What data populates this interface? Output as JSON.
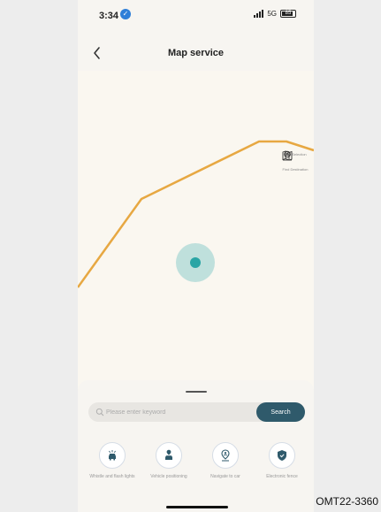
{
  "status_bar": {
    "time": "3:34",
    "time_badge": "✓",
    "network": "5G",
    "battery": "85"
  },
  "header": {
    "title": "Map service",
    "back_icon": "chevron-left-icon"
  },
  "map": {
    "route_color": "#e7a842",
    "location_color": "#2aa5a5",
    "tools": [
      {
        "icon": "map-icon",
        "label": "Map Selection"
      },
      {
        "icon": "location-person-icon",
        "label": "Find Destination"
      },
      {
        "icon": "compass-icon",
        "label": ""
      }
    ]
  },
  "search": {
    "placeholder": "Please enter keyword",
    "button_label": "Search"
  },
  "actions": [
    {
      "icon": "car-lights-icon",
      "label": "Whistle and flash lights"
    },
    {
      "icon": "car-location-icon",
      "label": "Vehicle positioning"
    },
    {
      "icon": "navigate-person-icon",
      "label": "Navigate to car"
    },
    {
      "icon": "shield-icon",
      "label": "Electronic fence"
    }
  ],
  "caption": "OMT22-3360"
}
